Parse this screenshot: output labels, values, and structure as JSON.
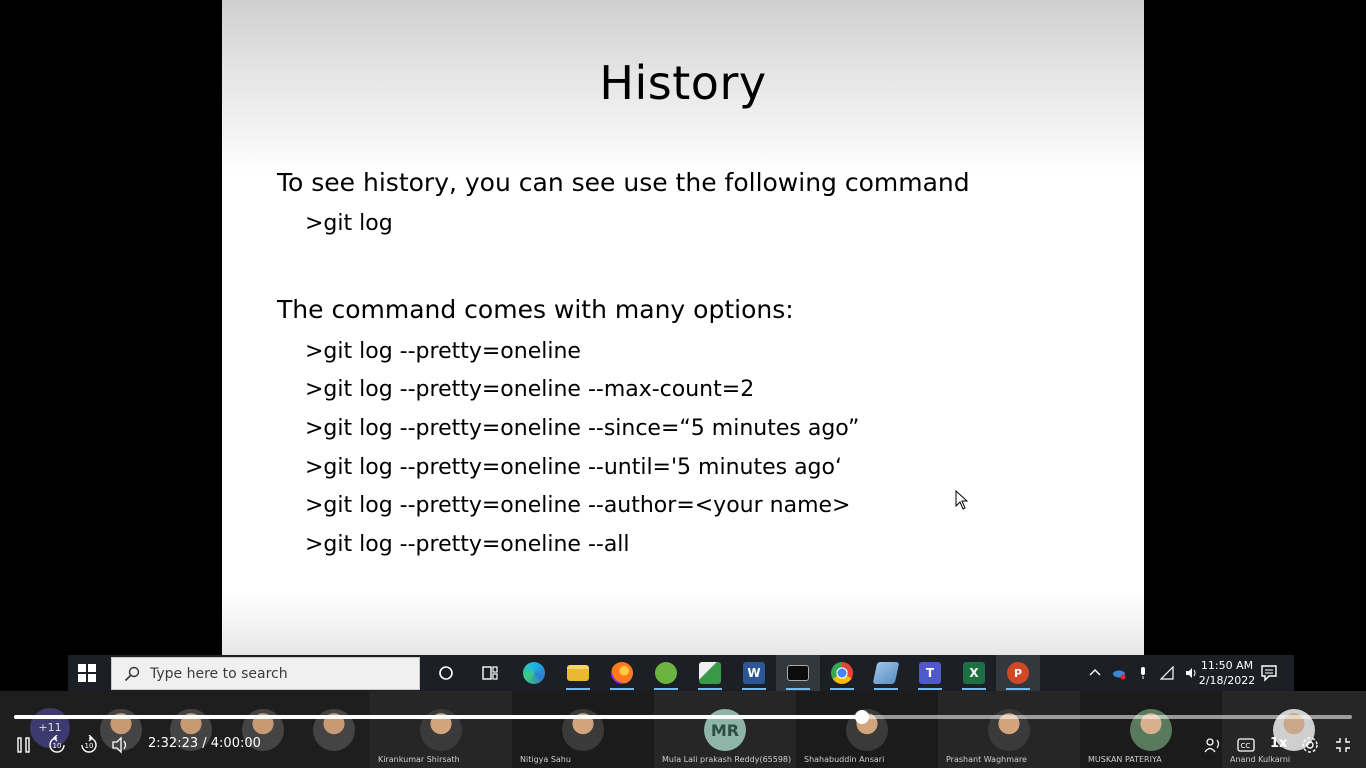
{
  "slide": {
    "title": "History",
    "line1": "To see history, you can see use the following command",
    "line2": ">git log",
    "line3": "The command comes with many options:",
    "options": [
      ">git log --pretty=oneline",
      ">git log --pretty=oneline --max-count=2",
      ">git log --pretty=oneline --since=“5 minutes ago”",
      ">git log --pretty=oneline --until='5 minutes ago‘",
      ">git log --pretty=oneline --author=<your name>",
      ">git log --pretty=oneline --all"
    ]
  },
  "taskbar": {
    "search_placeholder": "Type here to search",
    "clock_time": "11:50 AM",
    "clock_date": "2/18/2022",
    "icons": [
      "cortana-icon",
      "task-view-icon",
      "edge-icon",
      "file-explorer-icon",
      "firefox-icon",
      "spring-icon",
      "chart-app-icon",
      "word-icon",
      "terminal-icon",
      "chrome-icon",
      "notepad-icon",
      "teams-icon",
      "excel-icon",
      "powerpoint-icon"
    ]
  },
  "participants": {
    "more_count": "+11",
    "names": [
      "Kirankumar Shirsath",
      "Nitigya Sahu",
      "Mula Lali prakash Reddy(65598)",
      "Shahabuddin Ansari",
      "Prashant Waghmare",
      "MUSKAN PATERIYA",
      "Anand Kulkarni"
    ],
    "initials": "MR"
  },
  "player": {
    "current_time": "2:32:23",
    "separator": " / ",
    "total_time": "4:00:00",
    "progress": 0.634,
    "speed": "1x",
    "rewind_label": "10",
    "forward_label": "10"
  },
  "colors": {
    "taskbar_bg": "#1c2026",
    "running_indicator": "#76b9ed",
    "avatar_mr": "#8fb5a8"
  }
}
